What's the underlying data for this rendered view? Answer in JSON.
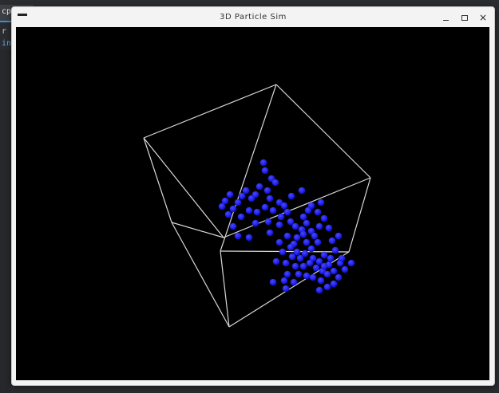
{
  "background_editor": {
    "tab_label": "cpp",
    "line1": "r ma",
    "line2": "in"
  },
  "window": {
    "title": "3D Particle Sim",
    "controls": {
      "minimize": "_",
      "maximize": "□",
      "close": "×"
    }
  },
  "scene": {
    "background_color": "#000000",
    "cube_edge_color": "#d8d8d8",
    "particle_color": "#1a1aff",
    "particle_count": 98
  }
}
